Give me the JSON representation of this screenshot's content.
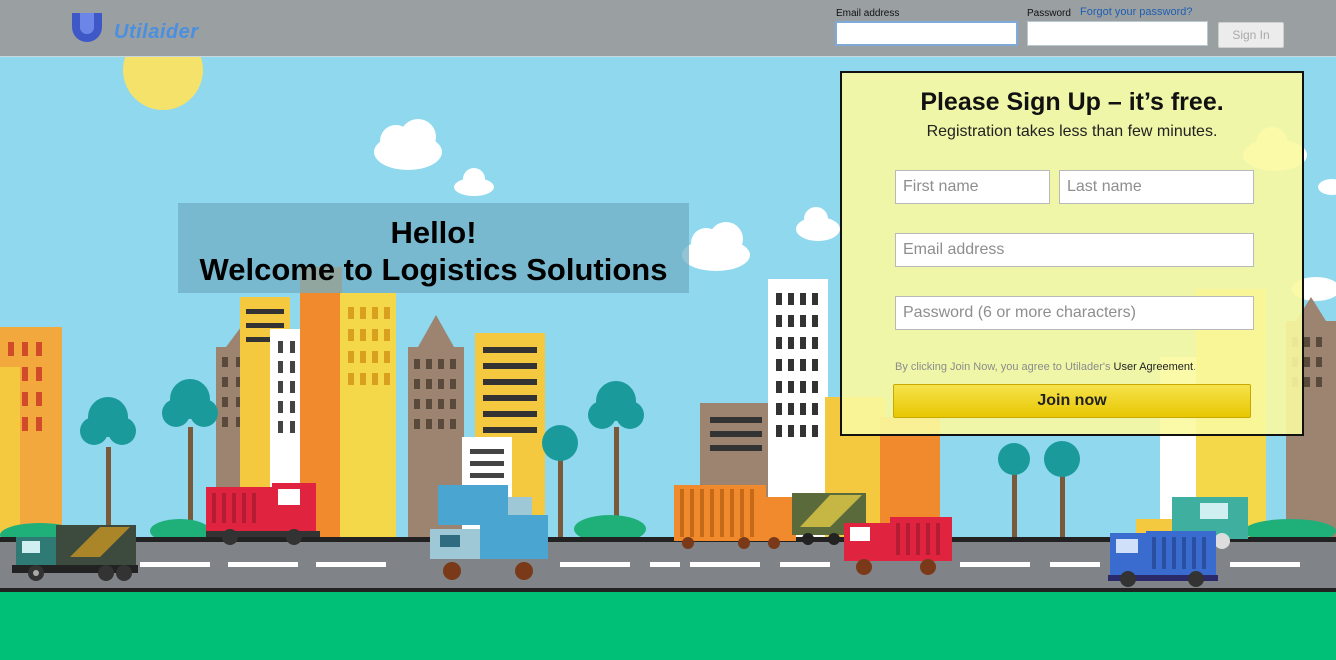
{
  "header": {
    "logo_text": "Utilaider",
    "email_label": "Email address",
    "password_label": "Password",
    "forgot_link": "Forgot your password?",
    "email_value": "",
    "password_value": "",
    "signin_label": "Sign In"
  },
  "hero": {
    "line1": "Hello!",
    "line2": "Welcome to Logistics Solutions"
  },
  "signup": {
    "title": "Please Sign Up – it’s free.",
    "subtitle": "Registration takes less than few minutes.",
    "first_name_placeholder": "First name",
    "last_name_placeholder": "Last name",
    "email_placeholder": "Email address",
    "password_placeholder": "Password (6 or more characters)",
    "terms_prefix": "By clicking Join Now, you agree to Utilader's ",
    "terms_link": "User Agreement",
    "terms_suffix": ".",
    "join_label": "Join now"
  },
  "colors": {
    "header_bg": "#9a9fa1",
    "sky": "#8fd8ee",
    "grass": "#00c077",
    "road": "#808488",
    "panel_bg": "#fafaa0",
    "join_button": "#f2d520",
    "link": "#1f5fb3"
  }
}
